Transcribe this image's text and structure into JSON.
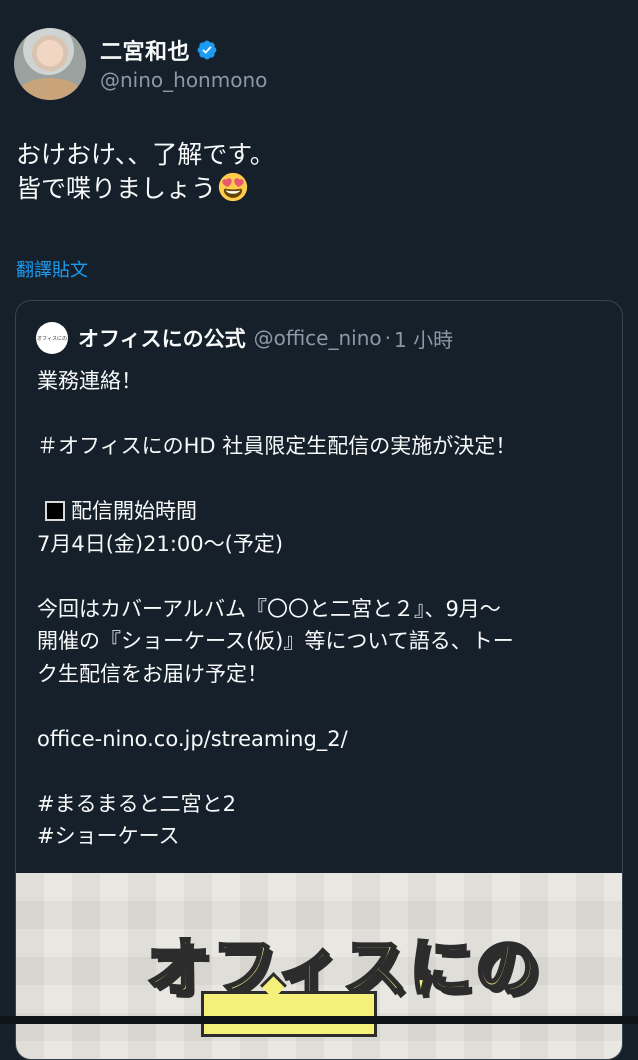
{
  "tweet": {
    "author_name": "二宮和也",
    "author_handle": "@nino_honmono",
    "text_lines": [
      "おけおけ、、了解です。",
      "皆で喋りましょう"
    ],
    "emoji_name": "heart-eyes-emoji",
    "translate_label": "翻譯貼文"
  },
  "quote": {
    "author_name": "オフィスにの公式",
    "author_handle": "@office_nino",
    "dot": "·",
    "time": "1 小時",
    "avatar_text": "オフィスにの",
    "lines": [
      "業務連絡！",
      "",
      "＃オフィスにのHD 社員限定生配信の実施が決定！",
      "",
      "配信開始時間",
      "7月4日(金)21:00～(予定)",
      "",
      "今回はカバーアルバム『〇〇と二宮と２』、9月～",
      "開催の『ショーケース(仮)』等について語る、トー",
      "ク生配信をお届け予定！",
      "",
      "office-nino.co.jp/streaming_2/",
      "",
      "#まるまると二宮と2",
      "#ショーケース"
    ],
    "media_title": "オフィスにの"
  },
  "colors": {
    "background": "#15202b",
    "text": "#f7f9f9",
    "secondary": "#8b98a5",
    "link": "#1d9bf0",
    "verified": "#1d9bf0"
  },
  "icons": {
    "verified": "verified-badge-icon",
    "square": "black-square-icon"
  }
}
